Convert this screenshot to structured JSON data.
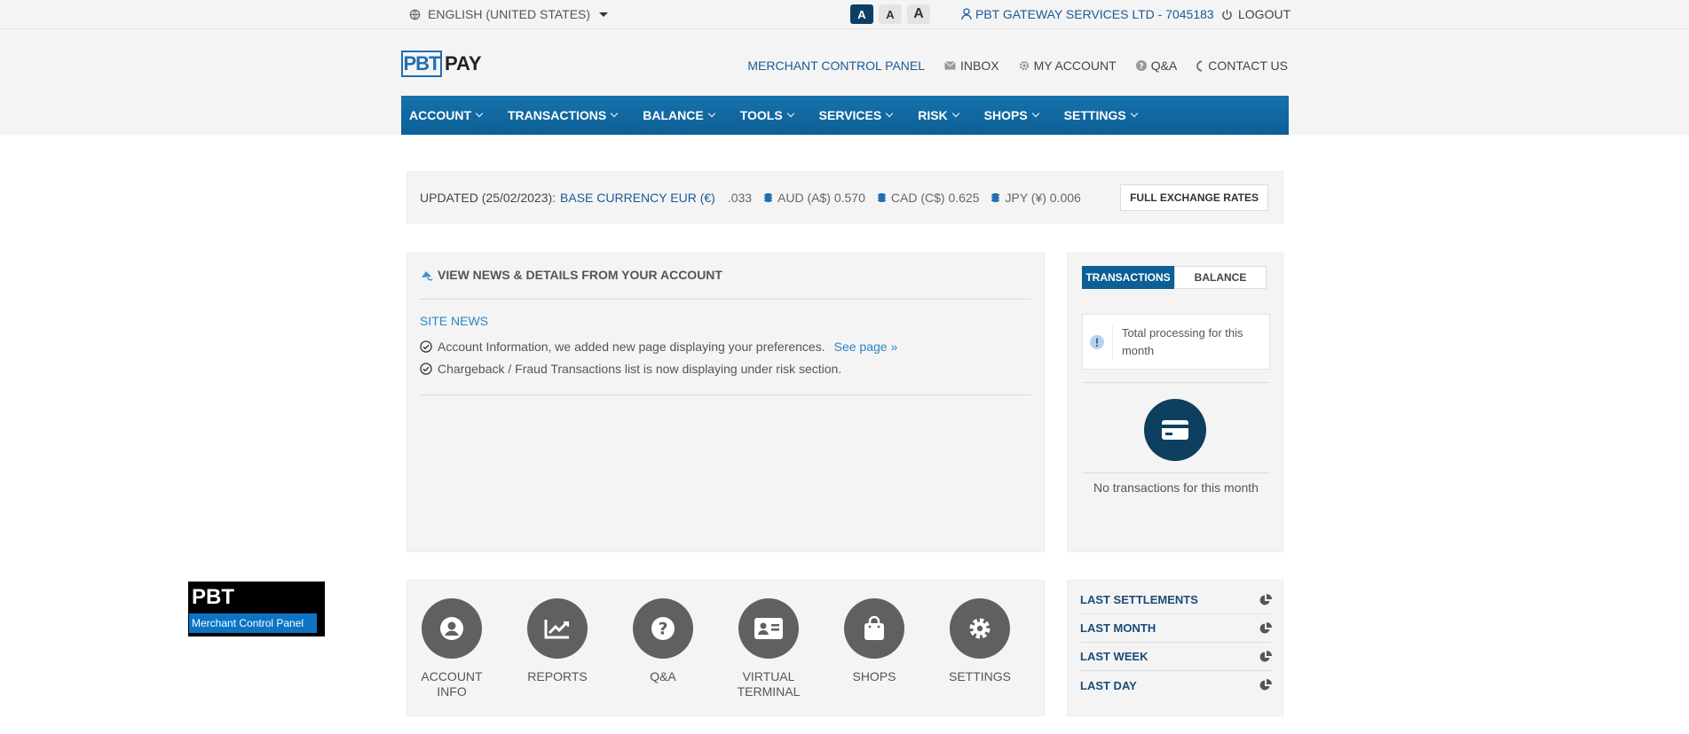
{
  "topbar": {
    "language": "ENGLISH (UNITED STATES)",
    "font_sizes": [
      "A",
      "A",
      "A"
    ],
    "account": "PBT GATEWAY SERVICES LTD - 7045183",
    "logout": "LOGOUT"
  },
  "header": {
    "logo_box": "PBT",
    "logo_text": "PAY",
    "links": {
      "control_panel": "MERCHANT CONTROL PANEL",
      "inbox": "INBOX",
      "my_account": "MY ACCOUNT",
      "qa": "Q&A",
      "contact": "CONTACT US"
    }
  },
  "nav": [
    "ACCOUNT",
    "TRANSACTIONS",
    "BALANCE",
    "TOOLS",
    "SERVICES",
    "RISK",
    "SHOPS",
    "SETTINGS"
  ],
  "rates": {
    "updated": "UPDATED (25/02/2023):",
    "base": "BASE CURRENCY EUR (€)",
    "partial": ".033",
    "currencies": [
      "AUD (A$) 0.570",
      "CAD (C$) 0.625",
      "JPY (¥) 0.006"
    ],
    "button": "FULL EXCHANGE RATES"
  },
  "news": {
    "title": "VIEW NEWS & DETAILS FROM YOUR ACCOUNT",
    "section": "SITE NEWS",
    "items": [
      "Account Information, we added new page displaying your preferences.",
      "Chargeback / Fraud Transactions list is now displaying under risk section."
    ],
    "see_page": "See page »"
  },
  "tx_panel": {
    "tab_transactions": "TRANSACTIONS",
    "tab_balance": "BALANCE",
    "info": "Total processing for this month",
    "empty": "No transactions for this month"
  },
  "quick": [
    "ACCOUNT INFO",
    "REPORTS",
    "Q&A",
    "VIRTUAL TERMINAL",
    "SHOPS",
    "SETTINGS"
  ],
  "settlements": [
    "LAST SETTLEMENTS",
    "LAST MONTH",
    "LAST WEEK",
    "LAST DAY"
  ],
  "badge": {
    "title": "PBT",
    "subtitle": "Merchant Control Panel"
  }
}
